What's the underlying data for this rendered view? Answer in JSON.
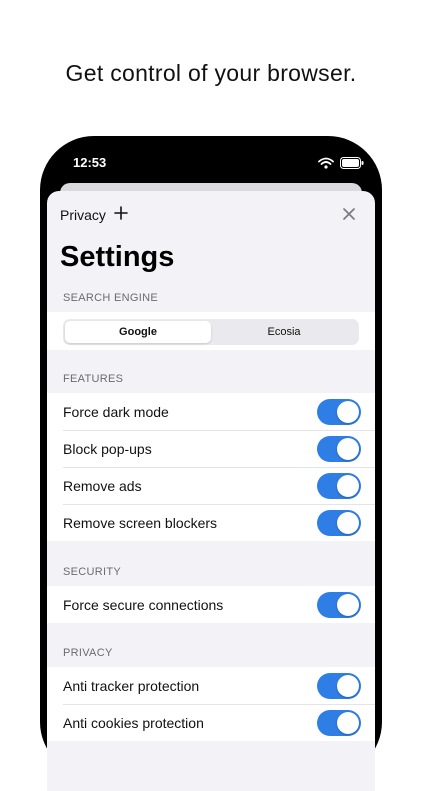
{
  "headline": "Get control of your browser.",
  "status_bar": {
    "time": "12:53",
    "icons": [
      "wifi-icon",
      "battery-icon"
    ]
  },
  "nav": {
    "tab_label": "Privacy",
    "add_icon": "plus-icon",
    "close_icon": "close-icon"
  },
  "title": "Settings",
  "search_engine": {
    "header": "SEARCH ENGINE",
    "options": [
      "Google",
      "Ecosia"
    ],
    "selected": "Google"
  },
  "features": {
    "header": "FEATURES",
    "items": [
      {
        "label": "Force dark mode",
        "enabled": true
      },
      {
        "label": "Block pop-ups",
        "enabled": true
      },
      {
        "label": "Remove ads",
        "enabled": true
      },
      {
        "label": "Remove screen blockers",
        "enabled": true
      }
    ]
  },
  "security": {
    "header": "SECURITY",
    "items": [
      {
        "label": "Force secure connections",
        "enabled": true
      }
    ]
  },
  "privacy": {
    "header": "PRIVACY",
    "items": [
      {
        "label": "Anti tracker protection",
        "enabled": true
      },
      {
        "label": "Anti cookies protection",
        "enabled": true
      }
    ]
  },
  "colors": {
    "toggle_on": "#2f7ee6",
    "background": "#f2f2f7"
  }
}
